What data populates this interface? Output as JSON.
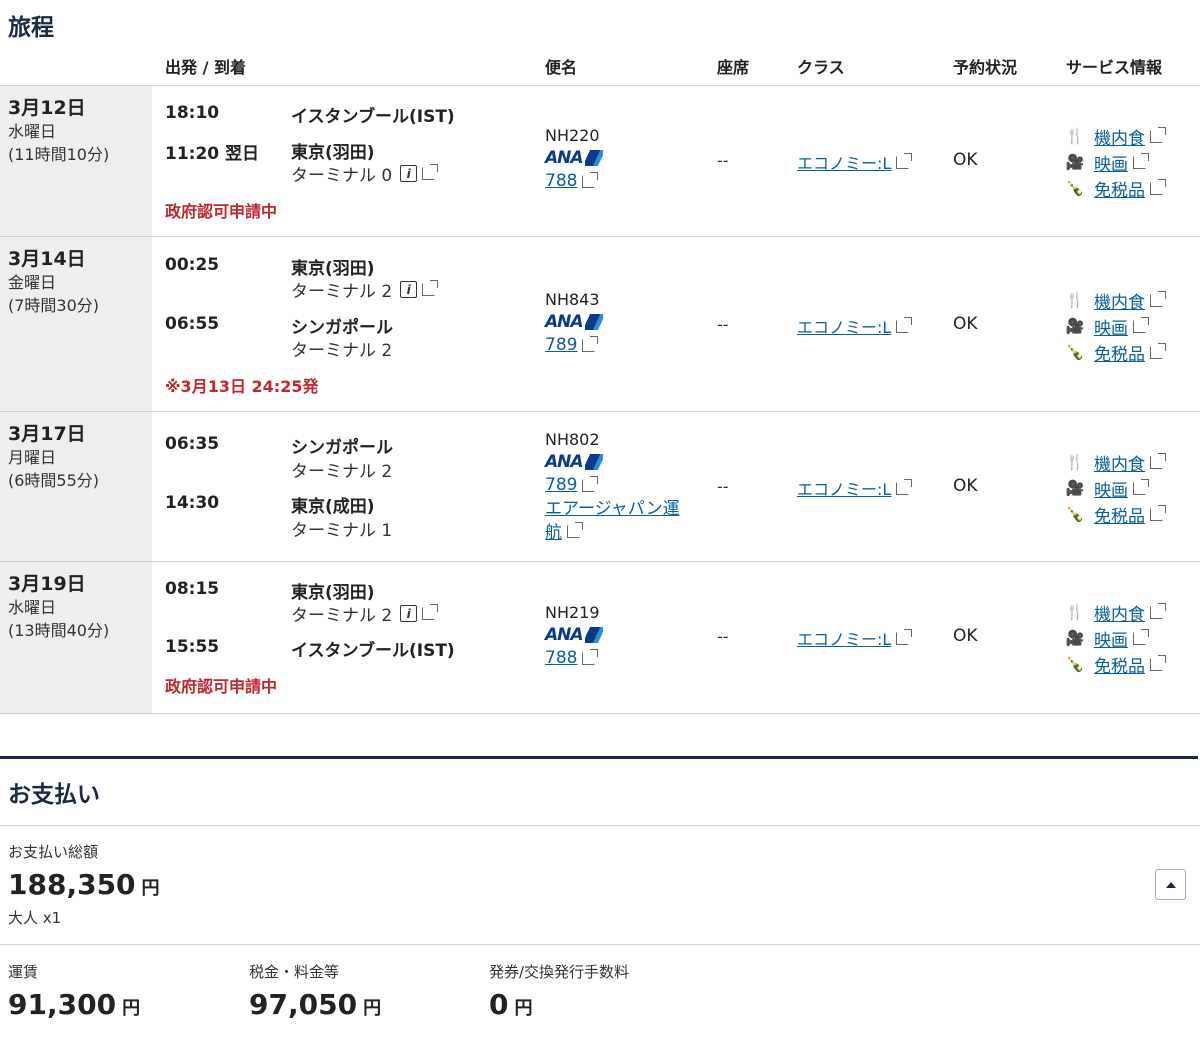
{
  "itinerary": {
    "title": "旅程",
    "headers": {
      "depart_arrive": "出発 / 到着",
      "flight": "便名",
      "seat": "座席",
      "class": "クラス",
      "status": "予約状況",
      "services": "サービス情報"
    },
    "segments": [
      {
        "date": "3月12日",
        "weekday": "水曜日",
        "duration": "(11時間10分)",
        "dep_time": "18:10",
        "dep_place": "イスタンブール(IST)",
        "dep_terminal": "",
        "arr_time": "11:20 翌日",
        "arr_place": "東京(羽田)",
        "arr_terminal": "ターミナル 0",
        "note": "政府認可申請中",
        "flight_no": "NH220",
        "airline_logo": "ANA",
        "aircraft": "788",
        "operator": "",
        "seat": "--",
        "class": "エコノミー:L",
        "status": "OK",
        "services": [
          "機内食",
          "映画",
          "免税品"
        ]
      },
      {
        "date": "3月14日",
        "weekday": "金曜日",
        "duration": "(7時間30分)",
        "dep_time": "00:25",
        "dep_place": "東京(羽田)",
        "dep_terminal": "ターミナル 2",
        "arr_time": "06:55",
        "arr_place": "シンガポール",
        "arr_terminal": "ターミナル 2",
        "note": "※3月13日 24:25発",
        "flight_no": "NH843",
        "airline_logo": "ANA",
        "aircraft": "789",
        "operator": "",
        "seat": "--",
        "class": "エコノミー:L",
        "status": "OK",
        "services": [
          "機内食",
          "映画",
          "免税品"
        ]
      },
      {
        "date": "3月17日",
        "weekday": "月曜日",
        "duration": "(6時間55分)",
        "dep_time": "06:35",
        "dep_place": "シンガポール",
        "dep_terminal": "ターミナル 2",
        "arr_time": "14:30",
        "arr_place": "東京(成田)",
        "arr_terminal": "ターミナル 1",
        "note": "",
        "flight_no": "NH802",
        "airline_logo": "ANA",
        "aircraft": "789",
        "operator_line1": "エアージャパン運",
        "operator_line2": "航",
        "seat": "--",
        "class": "エコノミー:L",
        "status": "OK",
        "services": [
          "機内食",
          "映画",
          "免税品"
        ]
      },
      {
        "date": "3月19日",
        "weekday": "水曜日",
        "duration": "(13時間40分)",
        "dep_time": "08:15",
        "dep_place": "東京(羽田)",
        "dep_terminal": "ターミナル 2",
        "arr_time": "15:55",
        "arr_place": "イスタンブール(IST)",
        "arr_terminal": "",
        "note": "政府認可申請中",
        "flight_no": "NH219",
        "airline_logo": "ANA",
        "aircraft": "788",
        "operator": "",
        "seat": "--",
        "class": "エコノミー:L",
        "status": "OK",
        "services": [
          "機内食",
          "映画",
          "免税品"
        ]
      }
    ]
  },
  "payment": {
    "title": "お支払い",
    "total_label": "お支払い総額",
    "total_amount": "188,350",
    "currency": "円",
    "passengers": "大人 x1",
    "fare_label": "運賃",
    "fare_amount": "91,300",
    "tax_label": "税金・料金等",
    "tax_amount": "97,050",
    "fee_label": "発券/交換発行手数料",
    "fee_amount": "0"
  },
  "icons": {
    "meal": "fork-knife-icon",
    "movie": "film-camera-icon",
    "dutyfree": "bottles-icon",
    "external": "external-link-icon",
    "info": "info-icon",
    "collapse": "caret-up-icon"
  },
  "colors": {
    "accent": "#1a2a44",
    "link": "#0a5e9e",
    "alert": "#c0282d",
    "date_bg": "#eeeeee"
  }
}
